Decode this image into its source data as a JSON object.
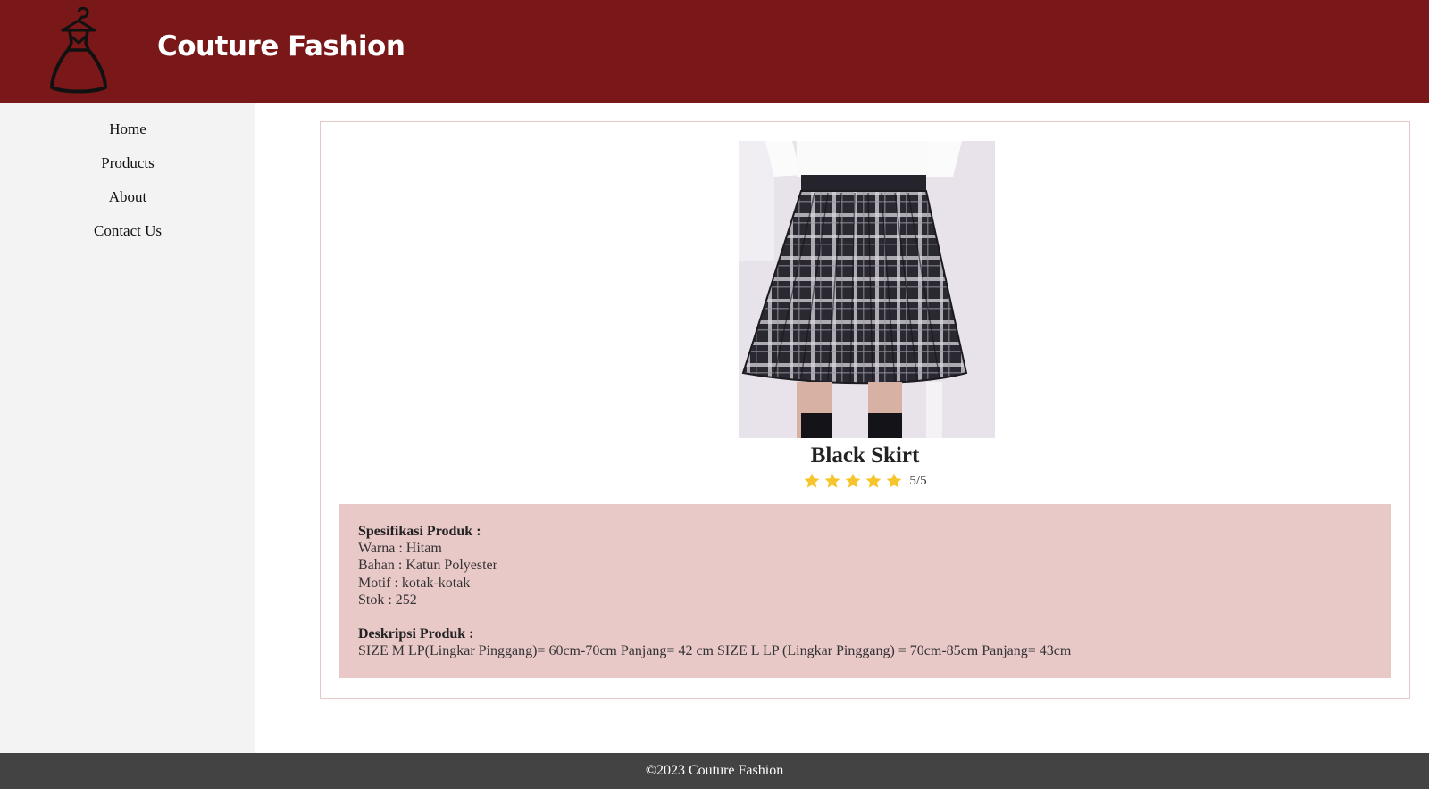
{
  "header": {
    "brand": "Couture Fashion",
    "logo_icon": "dress-hanger-icon"
  },
  "sidebar": {
    "items": [
      {
        "label": "Home"
      },
      {
        "label": "Products"
      },
      {
        "label": "About"
      },
      {
        "label": "Contact Us"
      }
    ]
  },
  "product": {
    "name": "Black Skirt",
    "rating": {
      "value": 5,
      "max": 5,
      "text": "5/5"
    },
    "spec": {
      "heading": "Spesifikasi Produk :",
      "lines": [
        "Warna : Hitam",
        "Bahan : Katun Polyester",
        "Motif : kotak-kotak",
        "Stok : 252"
      ]
    },
    "description": {
      "heading": "Deskripsi Produk :",
      "text": "SIZE M LP(Lingkar Pinggang)= 60cm-70cm Panjang= 42 cm SIZE L LP (Lingkar Pinggang) = 70cm-85cm Panjang= 43cm"
    }
  },
  "footer": {
    "text": "©2023 Couture Fashion"
  },
  "colors": {
    "header_bg": "#791719",
    "sidebar_bg": "#f3f3f3",
    "info_bg": "#e9c8c8",
    "footer_bg": "#434343",
    "star": "#f6c52c"
  }
}
